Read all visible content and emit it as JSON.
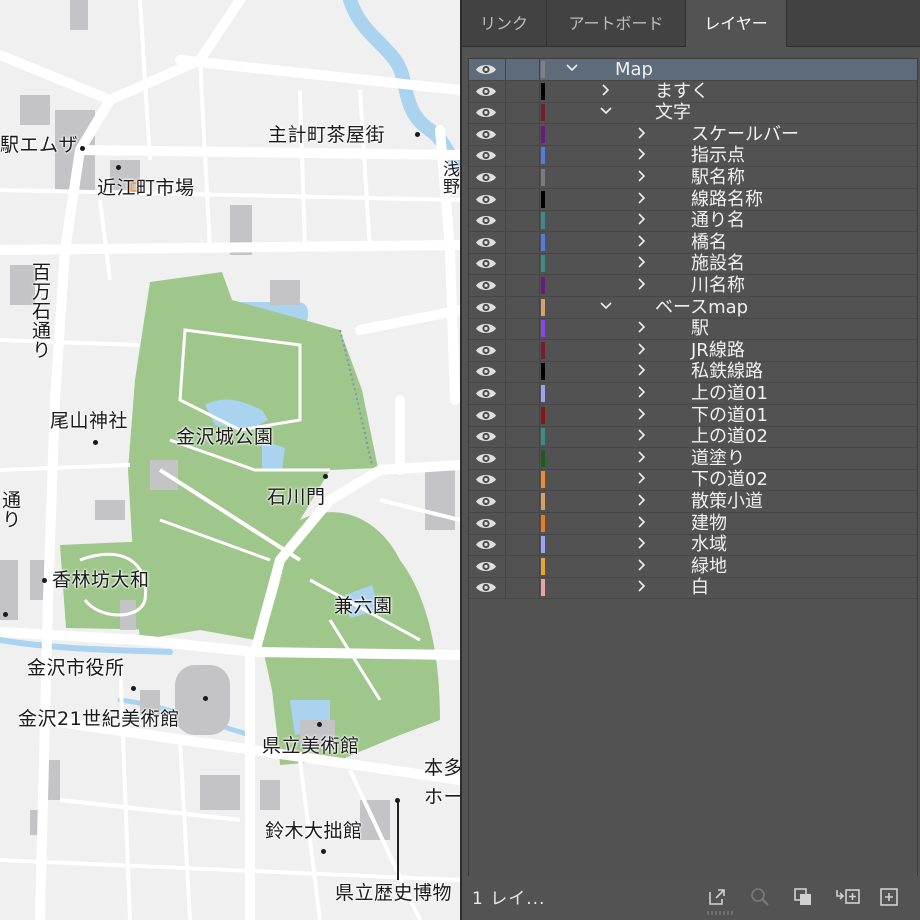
{
  "map": {
    "labels": {
      "station_emuza": "駅エムザ",
      "shukeimachi": "主計町茶屋街",
      "omicho": "近江町市場",
      "hyakumangoku": "百万石通り",
      "oyama": "尾山神社",
      "kanazawa_castle": "金沢城公園",
      "ishikawamon": "石川門",
      "korinbo": "香林坊大和",
      "kenrokuen": "兼六園",
      "city_hall": "金沢市役所",
      "museum21": "金沢21世紀美術館",
      "pref_museum": "県立美術館",
      "honda_partial": "本多",
      "hall_partial": "ホー",
      "suzuki": "鈴木大拙館",
      "history_museum": "県立歴史博物",
      "river_partial": "浅野",
      "left_partial": "通り"
    },
    "colors": {
      "background": "#f0f0f1",
      "road": "#ffffff",
      "road_edge": "#c9c9cc",
      "park": "#9fc78c",
      "water": "#a9d3ee",
      "building": "#bdbdbf"
    }
  },
  "panel": {
    "tabs": [
      {
        "label": "リンク",
        "active": false
      },
      {
        "label": "アートボード",
        "active": false
      },
      {
        "label": "レイヤー",
        "active": true
      }
    ],
    "layers": [
      {
        "name": "Map",
        "color": "#808080",
        "level": 0,
        "expanded": true
      },
      {
        "name": "ますく",
        "color": "#000000",
        "level": 1,
        "expanded": false
      },
      {
        "name": "文字",
        "color": "#7a1c2a",
        "level": 1,
        "expanded": true
      },
      {
        "name": "スケールバー",
        "color": "#6a1a7a",
        "level": 2,
        "expanded": false
      },
      {
        "name": "指示点",
        "color": "#4f7bef",
        "level": 2,
        "expanded": false
      },
      {
        "name": "駅名称",
        "color": "#7c7c7c",
        "level": 2,
        "expanded": false
      },
      {
        "name": "線路名称",
        "color": "#000000",
        "level": 2,
        "expanded": false
      },
      {
        "name": "通り名",
        "color": "#3c8c86",
        "level": 2,
        "expanded": false
      },
      {
        "name": "橋名",
        "color": "#4f7bef",
        "level": 2,
        "expanded": false
      },
      {
        "name": "施設名",
        "color": "#3c8c86",
        "level": 2,
        "expanded": false
      },
      {
        "name": "川名称",
        "color": "#6a1a7a",
        "level": 2,
        "expanded": false
      },
      {
        "name": "ベースmap",
        "color": "#d9a066",
        "level": 1,
        "expanded": true
      },
      {
        "name": "駅",
        "color": "#8a44f0",
        "level": 2,
        "expanded": false
      },
      {
        "name": "JR線路",
        "color": "#7a1c2a",
        "level": 2,
        "expanded": false
      },
      {
        "name": "私鉄線路",
        "color": "#000000",
        "level": 2,
        "expanded": false
      },
      {
        "name": "上の道01",
        "color": "#9aa3f5",
        "level": 2,
        "expanded": false
      },
      {
        "name": "下の道01",
        "color": "#8a1414",
        "level": 2,
        "expanded": false
      },
      {
        "name": "上の道02",
        "color": "#3c8c86",
        "level": 2,
        "expanded": false
      },
      {
        "name": "道塗り",
        "color": "#1f5a1f",
        "level": 2,
        "expanded": false
      },
      {
        "name": "下の道02",
        "color": "#f08c2a",
        "level": 2,
        "expanded": false
      },
      {
        "name": "散策小道",
        "color": "#d9a066",
        "level": 2,
        "expanded": false
      },
      {
        "name": "建物",
        "color": "#f07a1a",
        "level": 2,
        "expanded": false
      },
      {
        "name": "水域",
        "color": "#9aa3f5",
        "level": 2,
        "expanded": false
      },
      {
        "name": "緑地",
        "color": "#f0a030",
        "level": 2,
        "expanded": false
      },
      {
        "name": "白",
        "color": "#f0a0a0",
        "level": 2,
        "expanded": false
      }
    ],
    "footer": {
      "count": "1 レイ..."
    }
  }
}
